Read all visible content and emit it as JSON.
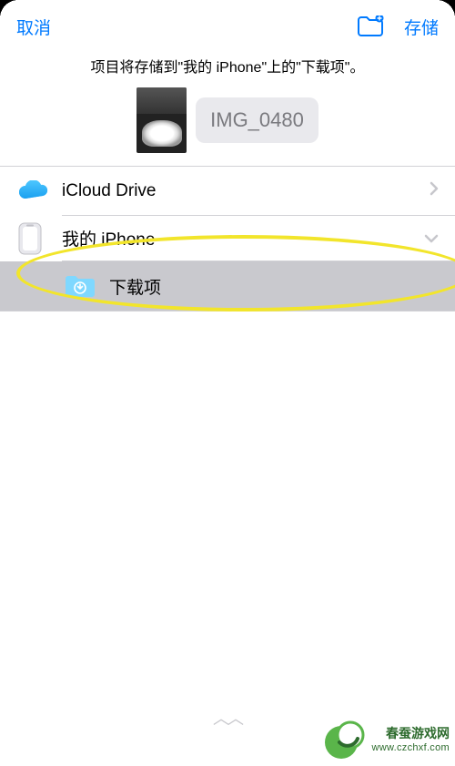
{
  "header": {
    "cancel": "取消",
    "save": "存储"
  },
  "subtitle": "项目将存储到\"我的 iPhone\"上的\"下载项\"。",
  "file": {
    "name": "IMG_0480"
  },
  "locations": {
    "icloud_label": "iCloud Drive",
    "iphone_label": "我的 iPhone",
    "downloads_label": "下载项"
  },
  "watermark": {
    "name_zh": "春蚕游戏网",
    "url": "www.czchxf.com"
  }
}
